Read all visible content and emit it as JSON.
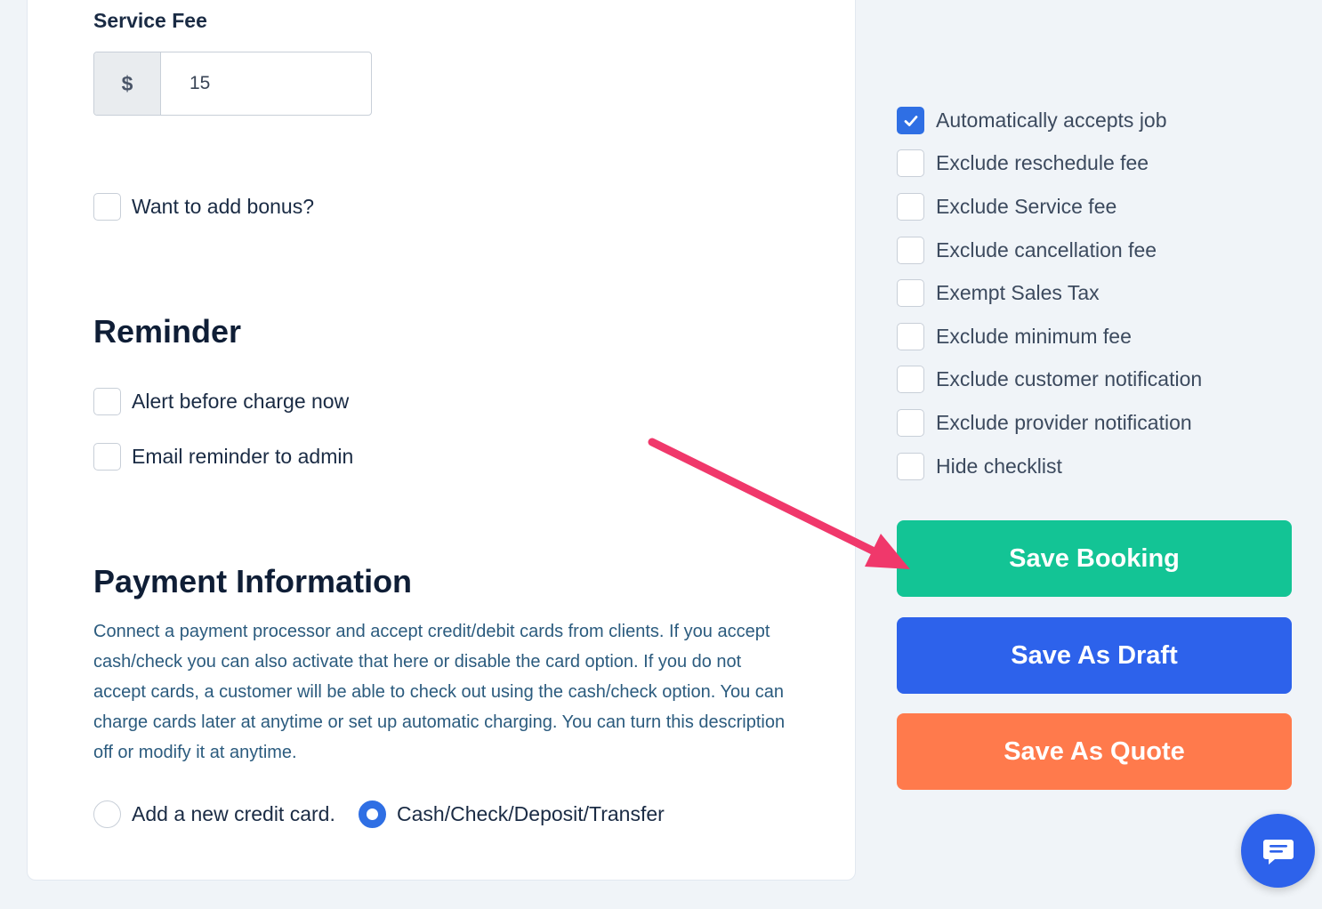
{
  "service_fee": {
    "label": "Service Fee",
    "currency_symbol": "$",
    "value": "15"
  },
  "bonus": {
    "label": "Want to add bonus?",
    "checked": false
  },
  "reminder": {
    "title": "Reminder",
    "options": [
      {
        "label": "Alert before charge now",
        "checked": false
      },
      {
        "label": "Email reminder to admin",
        "checked": false
      }
    ]
  },
  "payment": {
    "title": "Payment Information",
    "description": "Connect a payment processor and accept credit/debit cards from clients. If you accept cash/check you can also activate that here or disable the card option. If you do not accept cards, a customer will be able to check out using the cash/check option. You can charge cards later at anytime or set up automatic charging. You can turn this description off or modify it at anytime.",
    "methods": [
      {
        "label": "Add a new credit card.",
        "selected": false
      },
      {
        "label": "Cash/Check/Deposit/Transfer",
        "selected": true
      }
    ]
  },
  "options": [
    {
      "label": "Automatically accepts job",
      "checked": true
    },
    {
      "label": "Exclude reschedule fee",
      "checked": false
    },
    {
      "label": "Exclude Service fee",
      "checked": false
    },
    {
      "label": "Exclude cancellation fee",
      "checked": false
    },
    {
      "label": "Exempt Sales Tax",
      "checked": false
    },
    {
      "label": "Exclude minimum fee",
      "checked": false
    },
    {
      "label": "Exclude customer notification",
      "checked": false
    },
    {
      "label": "Exclude provider notification",
      "checked": false
    },
    {
      "label": "Hide checklist",
      "checked": false
    }
  ],
  "actions": {
    "save_booking": "Save Booking",
    "save_draft": "Save As Draft",
    "save_quote": "Save As Quote"
  },
  "colors": {
    "primary": "#2d62eb",
    "success": "#13c495",
    "warning": "#ff7a4c",
    "annotation_arrow": "#f0386b"
  },
  "icons": {
    "chat": "chat-icon",
    "check": "check-icon",
    "annotation": "arrow-annotation"
  }
}
